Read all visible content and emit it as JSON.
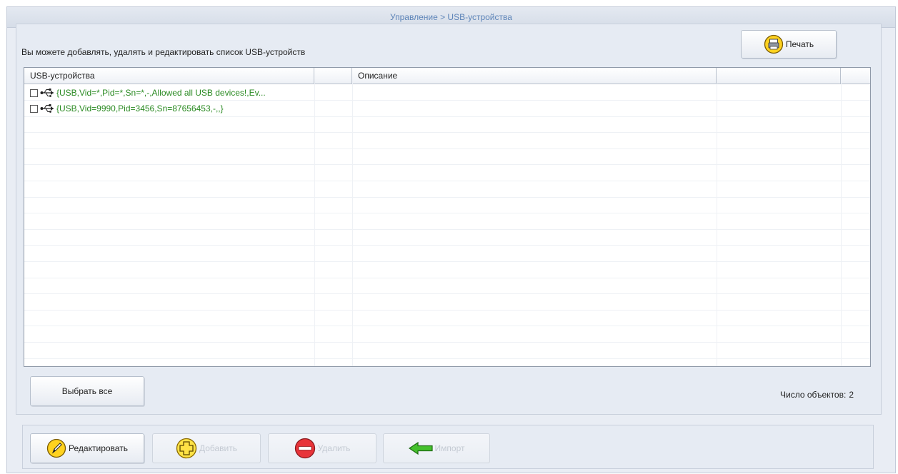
{
  "breadcrumb": "Управление > USB-устройства",
  "intro_text": "Вы можете добавлять, удалять и редактировать список USB-устройств",
  "toolbar": {
    "print_label": "Печать"
  },
  "table": {
    "columns": [
      "USB-устройства",
      "",
      "Описание",
      "",
      ""
    ],
    "rows": [
      {
        "checked": false,
        "icon": "usb-icon",
        "text": "{USB,Vid=*,Pid=*,Sn=*,-,Allowed all USB devices!,Ev..."
      },
      {
        "checked": false,
        "icon": "usb-icon",
        "text": "{USB,Vid=9990,Pid=3456,Sn=87656453,-,,}"
      }
    ]
  },
  "select_all_label": "Выбрать все",
  "count": {
    "label": "Число объектов:",
    "value": "2"
  },
  "actions": {
    "edit": {
      "label": "Редактировать",
      "enabled": true
    },
    "add": {
      "label": "Добавить",
      "enabled": false
    },
    "delete": {
      "label": "Удалить",
      "enabled": false
    },
    "import": {
      "label": "Импорт",
      "enabled": false
    }
  },
  "colors": {
    "accent": "#5d84b8",
    "row_text": "#2a8a22",
    "panel": "#e6ebf3"
  }
}
